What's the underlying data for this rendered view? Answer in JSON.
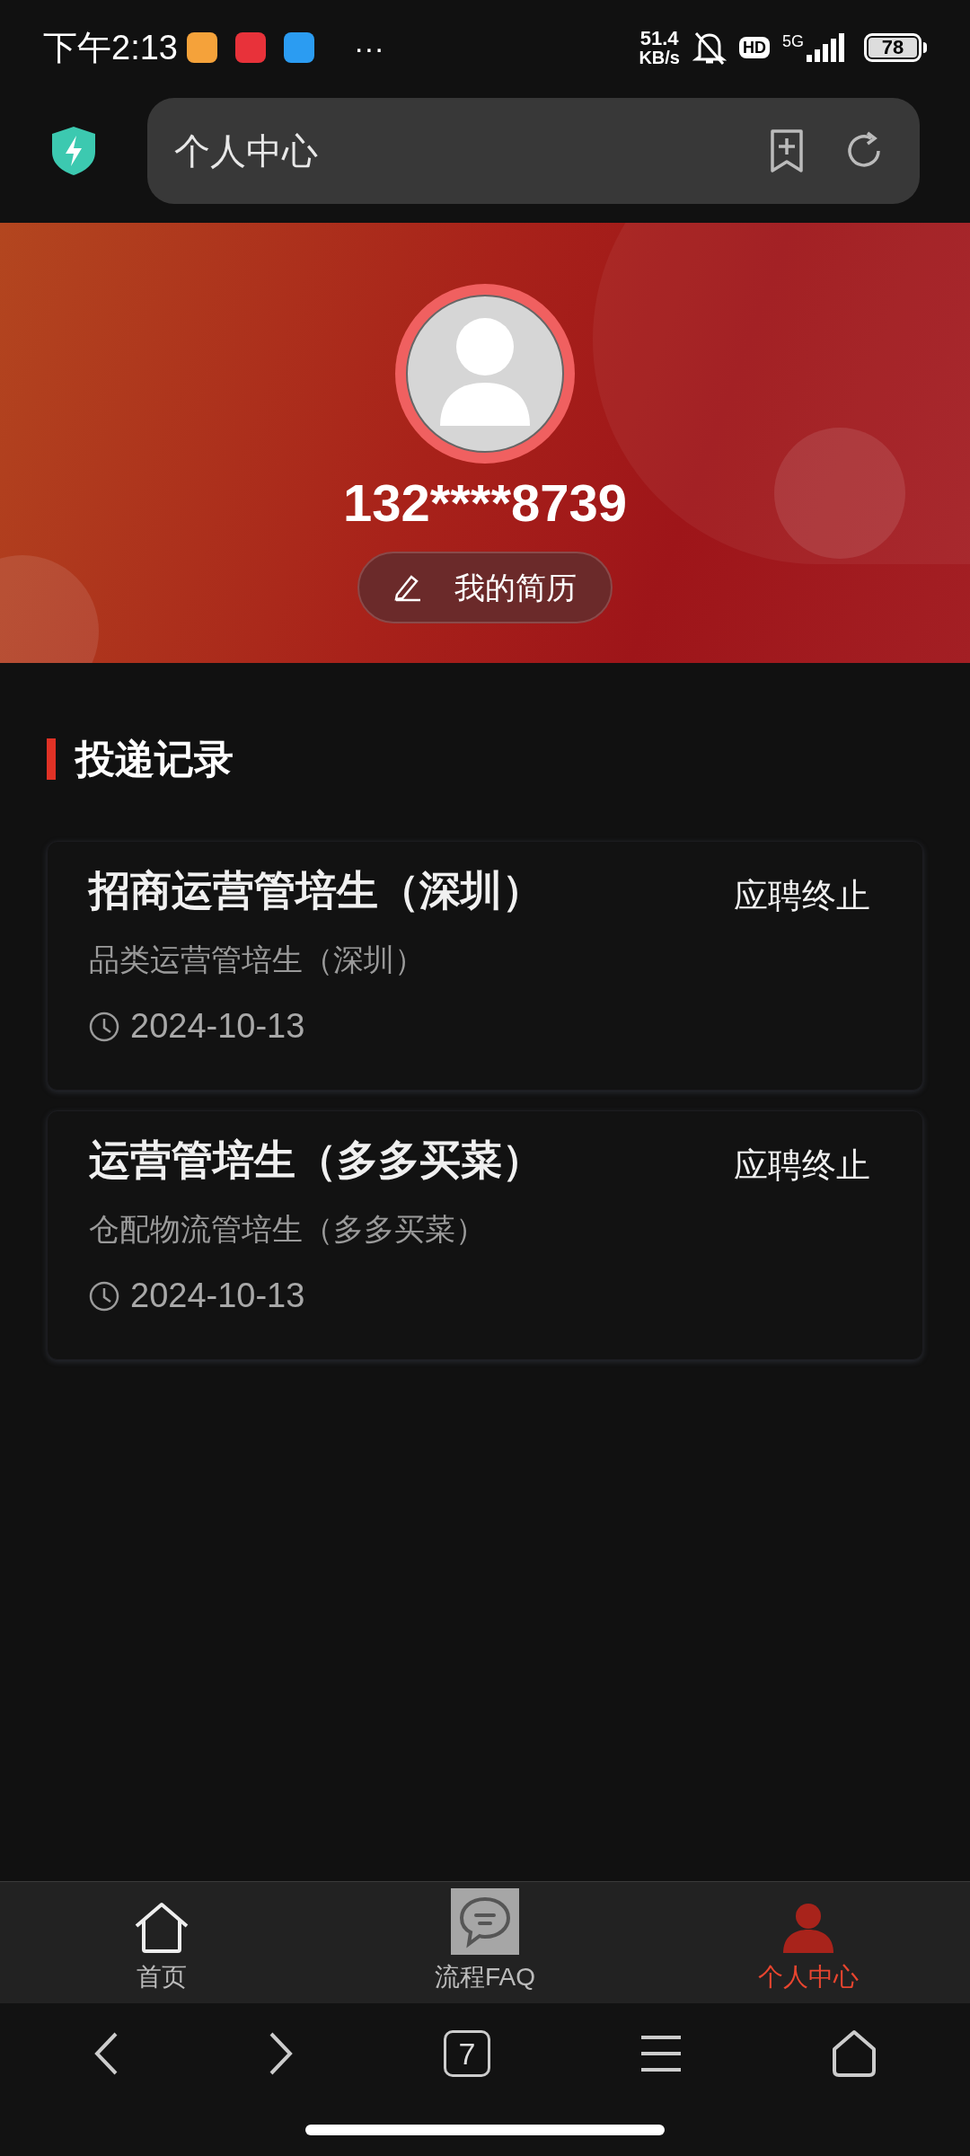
{
  "status_bar": {
    "time": "下午2:13",
    "app_icons": [
      {
        "color": "#f5a23a"
      },
      {
        "color": "#e8323a"
      },
      {
        "color": "#2b9cf2"
      }
    ],
    "more": "···",
    "speed_value": "51.4",
    "speed_unit": "KB/s",
    "hd": "HD",
    "network": "5G",
    "battery": "78"
  },
  "browser_bar": {
    "address": "个人中心"
  },
  "profile": {
    "phone": "132****8739",
    "resume_button": "我的简历"
  },
  "section": {
    "title": "投递记录"
  },
  "applications": [
    {
      "title": "招商运营管培生（深圳）",
      "position": "品类运营管培生（深圳）",
      "status": "应聘终止",
      "date": "2024-10-13"
    },
    {
      "title": "运营管培生（多多买菜）",
      "position": "仓配物流管培生（多多买菜）",
      "status": "应聘终止",
      "date": "2024-10-13"
    }
  ],
  "tabs": [
    {
      "kind": "home",
      "label": "首页",
      "selected": false
    },
    {
      "kind": "faq",
      "label": "流程FAQ",
      "selected": false
    },
    {
      "kind": "profile",
      "label": "个人中心",
      "selected": true
    }
  ],
  "browser_nav": {
    "tab_count": "7"
  }
}
